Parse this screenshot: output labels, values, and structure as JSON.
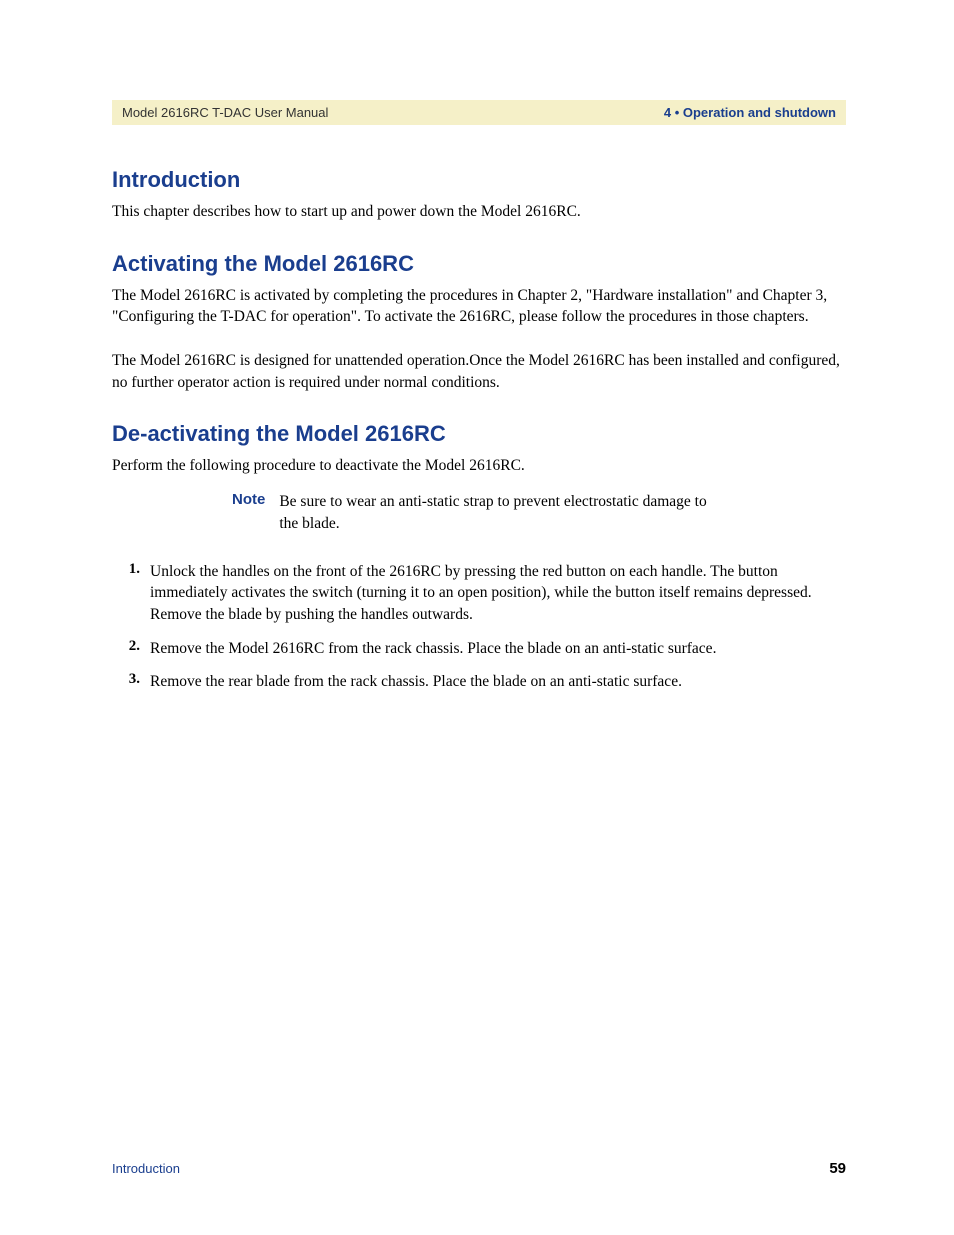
{
  "header": {
    "left": "Model 2616RC T-DAC User Manual",
    "right": "4 • Operation and shutdown"
  },
  "sections": {
    "introduction": {
      "title": "Introduction",
      "body": "This chapter describes how to start up and power down the Model 2616RC."
    },
    "activating": {
      "title": "Activating the Model 2616RC",
      "para1": "The Model 2616RC is activated by completing the procedures in Chapter 2, \"Hardware installation\" and Chapter 3, \"Configuring the T-DAC for operation\". To activate the 2616RC, please follow the procedures in those chapters.",
      "para2": "The Model 2616RC is designed for unattended operation.Once the Model 2616RC has been installed and configured, no further operator action is required under normal conditions."
    },
    "deactivating": {
      "title": "De-activating the Model 2616RC",
      "intro": "Perform the following procedure to deactivate the Model 2616RC.",
      "note_label": "Note",
      "note_text": "Be sure to wear an anti-static strap to prevent electrostatic damage to the blade.",
      "steps": [
        {
          "num": "1.",
          "text": "Unlock the handles on the front of the 2616RC by pressing the red button on each handle. The button immediately activates the switch (turning it to an open position), while the button itself remains depressed. Remove the blade by pushing the handles outwards."
        },
        {
          "num": "2.",
          "text": "Remove the Model 2616RC from the rack chassis. Place the blade on an anti-static surface."
        },
        {
          "num": "3.",
          "text": "Remove the rear blade from the rack chassis. Place the blade on an anti-static surface."
        }
      ]
    }
  },
  "footer": {
    "left": "Introduction",
    "right": "59"
  }
}
